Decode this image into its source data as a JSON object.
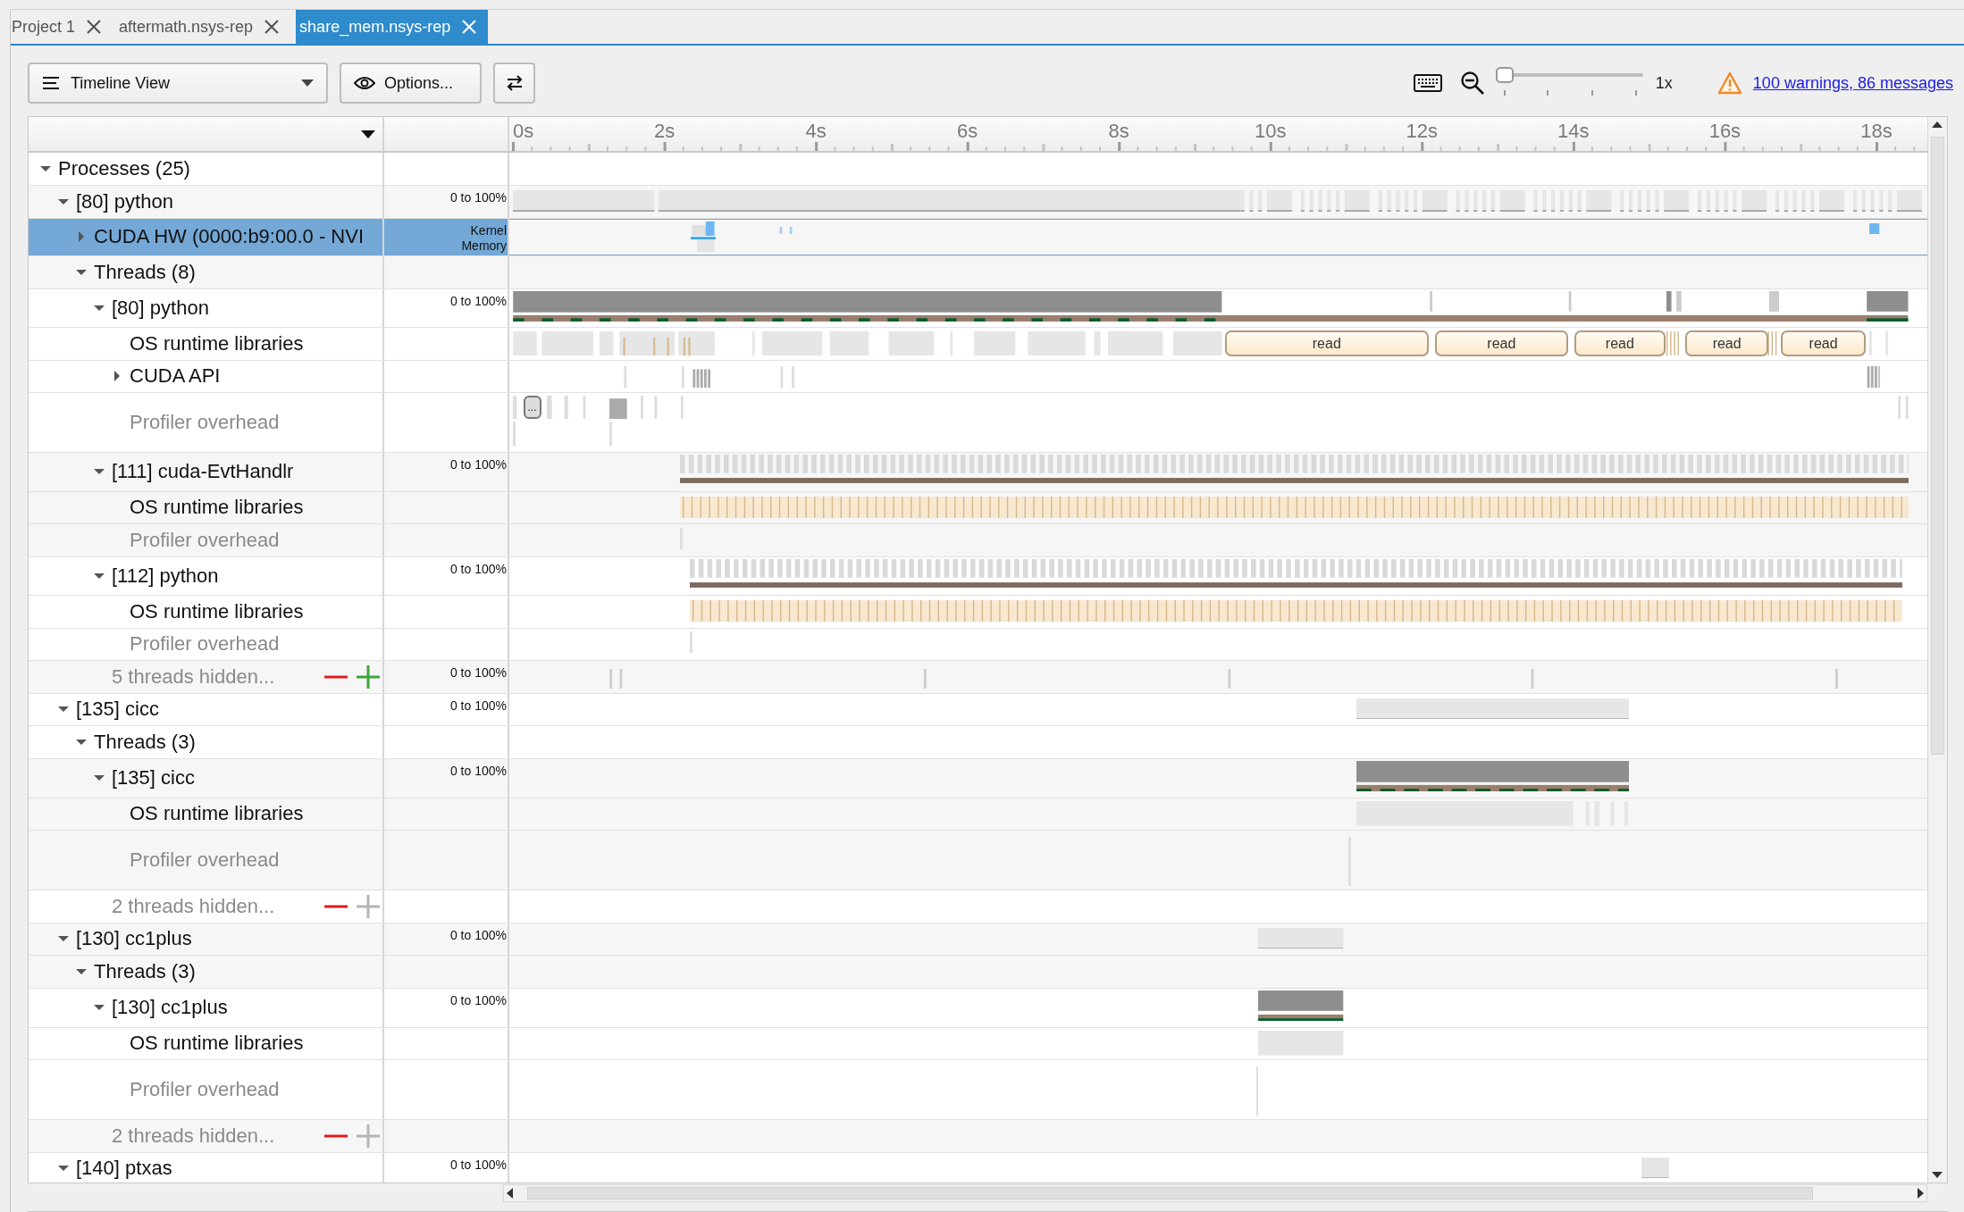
{
  "tabs": [
    {
      "label": "Project 1",
      "selected": false
    },
    {
      "label": "aftermath.nsys-rep",
      "selected": false
    },
    {
      "label": "share_mem.nsys-rep",
      "selected": true
    }
  ],
  "toolbar": {
    "view": "Timeline View",
    "options": "Options...",
    "zoom_slider": {
      "level": 0
    },
    "zoom_reading": "1x",
    "warnings_link": "100 warnings, 86 messages"
  },
  "ruler": {
    "ticks": [
      "0s",
      "2s",
      "4s",
      "6s",
      "8s",
      "10s",
      "12s",
      "14s",
      "16s",
      "18s"
    ]
  },
  "tree": [
    {
      "label": "Processes (25)",
      "kind": "group",
      "expanded": true,
      "selected": false,
      "children": [
        {
          "label": "[80] python",
          "kind": "process",
          "expanded": true,
          "selected": false,
          "scale": "0 to 100%",
          "children": [
            {
              "label": "CUDA HW (0000:b9:00.0 - NVI",
              "kind": "device",
              "expanded": false,
              "selected": true,
              "scale_lines": [
                "Kernel",
                "Memory"
              ]
            },
            {
              "label": "Threads (8)",
              "kind": "group",
              "expanded": true,
              "selected": false,
              "children": [
                {
                  "label": "[80] python",
                  "kind": "thread",
                  "expanded": true,
                  "selected": false,
                  "scale": "0 to 100%",
                  "children": [
                    {
                      "label": "OS runtime libraries",
                      "kind": "library",
                      "selected": false,
                      "events": [
                        "read",
                        "read",
                        "read",
                        "read",
                        "read"
                      ]
                    },
                    {
                      "label": "CUDA API",
                      "kind": "api",
                      "expanded": false,
                      "selected": false
                    },
                    {
                      "label": "Profiler overhead",
                      "kind": "overhead",
                      "selected": false,
                      "marker": "..."
                    }
                  ]
                },
                {
                  "label": "[111] cuda-EvtHandlr",
                  "kind": "thread",
                  "expanded": true,
                  "selected": false,
                  "scale": "0 to 100%",
                  "children": [
                    {
                      "label": "OS runtime libraries",
                      "kind": "library",
                      "selected": false
                    },
                    {
                      "label": "Profiler overhead",
                      "kind": "overhead",
                      "selected": false
                    }
                  ]
                },
                {
                  "label": "[112] python",
                  "kind": "thread",
                  "expanded": true,
                  "selected": false,
                  "scale": "0 to 100%",
                  "children": [
                    {
                      "label": "OS runtime libraries",
                      "kind": "library",
                      "selected": false
                    },
                    {
                      "label": "Profiler overhead",
                      "kind": "overhead",
                      "selected": false
                    }
                  ]
                },
                {
                  "label": "5 threads hidden...",
                  "kind": "hidden",
                  "selected": false,
                  "plus_enabled": true,
                  "scale": "0 to 100%"
                }
              ]
            }
          ]
        },
        {
          "label": "[135] cicc",
          "kind": "process",
          "expanded": true,
          "selected": false,
          "scale": "0 to 100%",
          "children": [
            {
              "label": "Threads (3)",
              "kind": "group",
              "expanded": true,
              "selected": false,
              "children": [
                {
                  "label": "[135] cicc",
                  "kind": "thread",
                  "expanded": true,
                  "selected": false,
                  "scale": "0 to 100%",
                  "children": [
                    {
                      "label": "OS runtime libraries",
                      "kind": "library",
                      "selected": false
                    },
                    {
                      "label": "Profiler overhead",
                      "kind": "overhead",
                      "selected": false
                    }
                  ]
                },
                {
                  "label": "2 threads hidden...",
                  "kind": "hidden",
                  "selected": false,
                  "plus_enabled": false
                }
              ]
            }
          ]
        },
        {
          "label": "[130] cc1plus",
          "kind": "process",
          "expanded": true,
          "selected": false,
          "scale": "0 to 100%",
          "children": [
            {
              "label": "Threads (3)",
              "kind": "group",
              "expanded": true,
              "selected": false,
              "children": [
                {
                  "label": "[130] cc1plus",
                  "kind": "thread",
                  "expanded": true,
                  "selected": false,
                  "scale": "0 to 100%",
                  "children": [
                    {
                      "label": "OS runtime libraries",
                      "kind": "library",
                      "selected": false
                    },
                    {
                      "label": "Profiler overhead",
                      "kind": "overhead",
                      "selected": false
                    }
                  ]
                },
                {
                  "label": "2 threads hidden...",
                  "kind": "hidden",
                  "selected": false,
                  "plus_enabled": false
                }
              ]
            }
          ]
        },
        {
          "label": "[140] ptxas",
          "kind": "process",
          "expanded": true,
          "selected": false,
          "scale": "0 to 100%"
        }
      ]
    }
  ]
}
